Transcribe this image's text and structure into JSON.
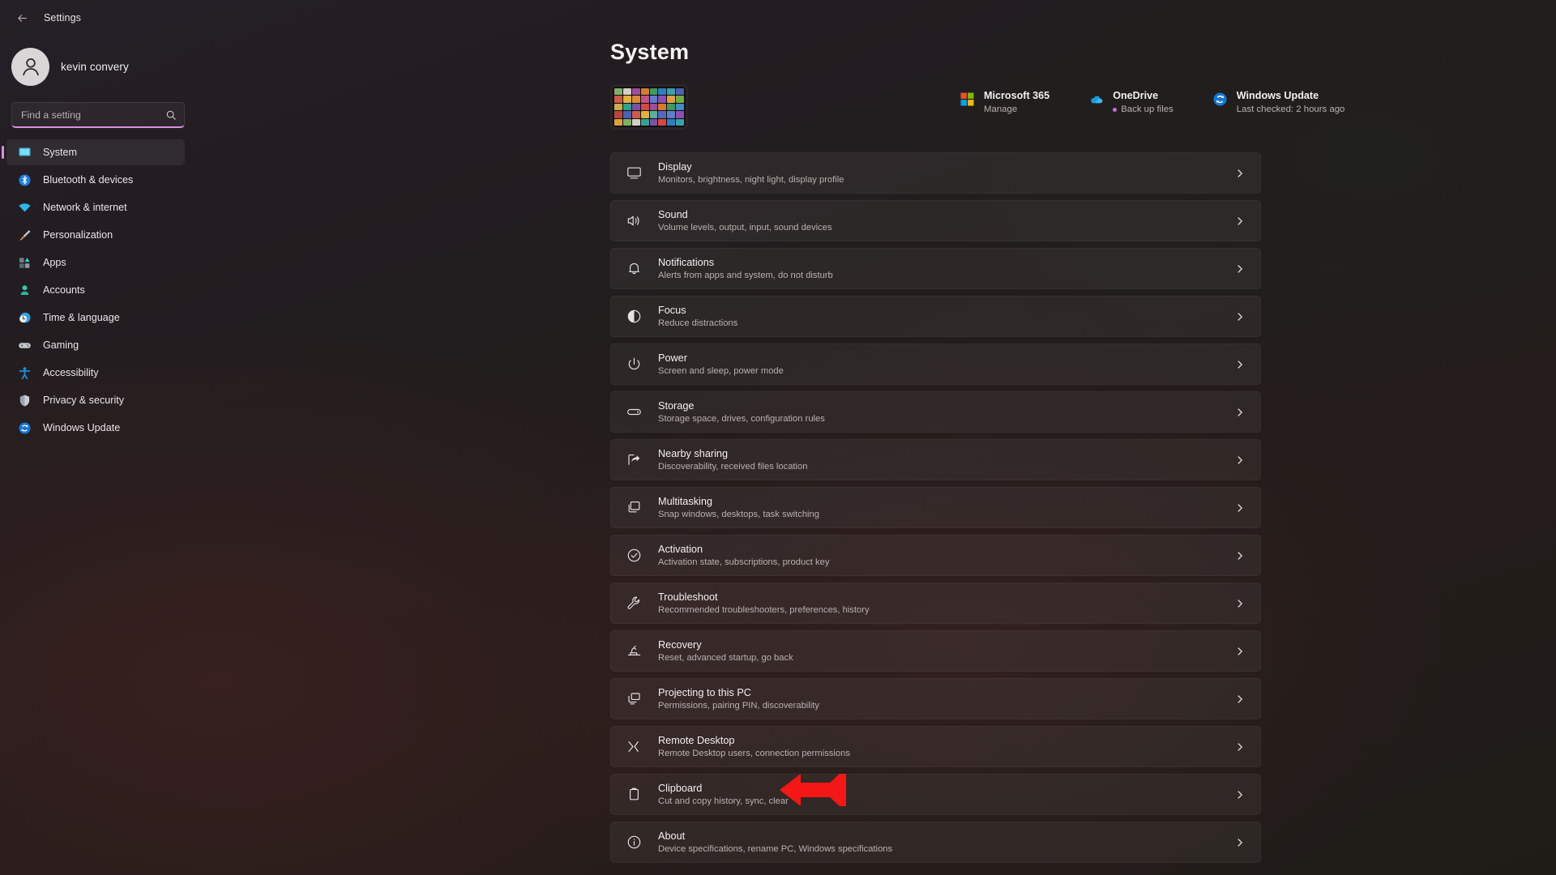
{
  "titlebar": {
    "back_label": "back-arrow",
    "title": "Settings"
  },
  "sidebar": {
    "account": {
      "name": "kevin convery",
      "avatar_icon": "person-icon"
    },
    "search": {
      "placeholder": "Find a setting",
      "value": "",
      "icon": "search-icon"
    },
    "items": [
      {
        "label": "System",
        "icon": "monitor-icon",
        "selected": true
      },
      {
        "label": "Bluetooth & devices",
        "icon": "bluetooth-icon",
        "selected": false
      },
      {
        "label": "Network & internet",
        "icon": "wifi-icon",
        "selected": false
      },
      {
        "label": "Personalization",
        "icon": "paintbrush-icon",
        "selected": false
      },
      {
        "label": "Apps",
        "icon": "apps-icon",
        "selected": false
      },
      {
        "label": "Accounts",
        "icon": "account-icon",
        "selected": false
      },
      {
        "label": "Time & language",
        "icon": "clock-icon",
        "selected": false
      },
      {
        "label": "Gaming",
        "icon": "gamepad-icon",
        "selected": false
      },
      {
        "label": "Accessibility",
        "icon": "accessibility-icon",
        "selected": false
      },
      {
        "label": "Privacy & security",
        "icon": "shield-icon",
        "selected": false
      },
      {
        "label": "Windows Update",
        "icon": "update-icon",
        "selected": false
      }
    ]
  },
  "main": {
    "page_title": "System",
    "device_thumbnail": "device-wallpaper-thumbnail",
    "hero_cards": [
      {
        "title": "Microsoft 365",
        "subtitle": "Manage",
        "icon": "microsoft-365-icon",
        "has_dot": false
      },
      {
        "title": "OneDrive",
        "subtitle": "Back up files",
        "icon": "onedrive-cloud-icon",
        "has_dot": true
      },
      {
        "title": "Windows Update",
        "subtitle": "Last checked: 2 hours ago",
        "icon": "windows-update-icon",
        "has_dot": false
      }
    ],
    "settings": [
      {
        "title": "Display",
        "subtitle": "Monitors, brightness, night light, display profile",
        "icon": "display-icon"
      },
      {
        "title": "Sound",
        "subtitle": "Volume levels, output, input, sound devices",
        "icon": "sound-icon"
      },
      {
        "title": "Notifications",
        "subtitle": "Alerts from apps and system, do not disturb",
        "icon": "bell-icon"
      },
      {
        "title": "Focus",
        "subtitle": "Reduce distractions",
        "icon": "focus-icon"
      },
      {
        "title": "Power",
        "subtitle": "Screen and sleep, power mode",
        "icon": "power-icon"
      },
      {
        "title": "Storage",
        "subtitle": "Storage space, drives, configuration rules",
        "icon": "storage-icon"
      },
      {
        "title": "Nearby sharing",
        "subtitle": "Discoverability, received files location",
        "icon": "nearby-share-icon"
      },
      {
        "title": "Multitasking",
        "subtitle": "Snap windows, desktops, task switching",
        "icon": "multitasking-icon"
      },
      {
        "title": "Activation",
        "subtitle": "Activation state, subscriptions, product key",
        "icon": "activation-check-icon"
      },
      {
        "title": "Troubleshoot",
        "subtitle": "Recommended troubleshooters, preferences, history",
        "icon": "wrench-icon"
      },
      {
        "title": "Recovery",
        "subtitle": "Reset, advanced startup, go back",
        "icon": "recovery-icon"
      },
      {
        "title": "Projecting to this PC",
        "subtitle": "Permissions, pairing PIN, discoverability",
        "icon": "projecting-icon"
      },
      {
        "title": "Remote Desktop",
        "subtitle": "Remote Desktop users, connection permissions",
        "icon": "remote-desktop-icon"
      },
      {
        "title": "Clipboard",
        "subtitle": "Cut and copy history, sync, clear",
        "icon": "clipboard-icon"
      },
      {
        "title": "About",
        "subtitle": "Device specifications, rename PC, Windows specifications",
        "icon": "info-icon"
      }
    ]
  },
  "annotation": {
    "arrow": "red-left-arrow-pointing-at-clipboard",
    "color": "#f51616"
  },
  "colors": {
    "accent": "#d98fe0",
    "annotation_red": "#f51616",
    "text_primary": "#f3f0ef",
    "text_secondary": "#b8b1b0",
    "row_background": "rgba(255,255,255,0.052)"
  }
}
